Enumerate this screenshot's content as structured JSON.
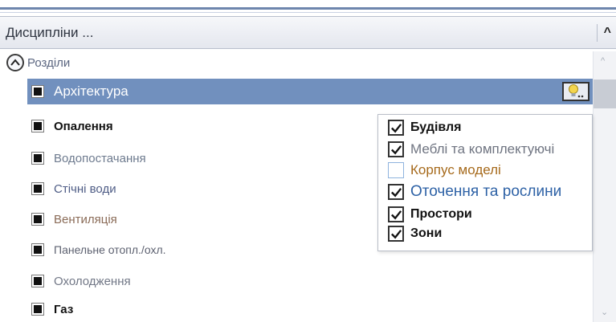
{
  "header": {
    "title": "Дисципліни ...",
    "chevron": "^"
  },
  "section": {
    "label": "Розділи"
  },
  "rows": [
    {
      "label": "Архітектура",
      "color": "#ffffff",
      "bold": false,
      "size": 17
    },
    {
      "label": "Опалення",
      "color": "#111111",
      "bold": true,
      "size": 15
    },
    {
      "label": "Водопостачання",
      "color": "#6d7a8e",
      "bold": false,
      "size": 15
    },
    {
      "label": "Стічні води",
      "color": "#4f5d86",
      "bold": false,
      "size": 15
    },
    {
      "label": "Вентиляція",
      "color": "#8a6b57",
      "bold": false,
      "size": 15
    },
    {
      "label": "Панельне отопл./охл.",
      "color": "#5d6170",
      "bold": false,
      "size": 14
    },
    {
      "label": "Охолодження",
      "color": "#717786",
      "bold": false,
      "size": 15
    },
    {
      "label": "Газ",
      "color": "#111111",
      "bold": true,
      "size": 15
    }
  ],
  "popup": {
    "items": [
      {
        "label": "Будівля",
        "checked": true,
        "color": "#111111",
        "bold": true,
        "size": 16
      },
      {
        "label": "Меблі та комплектуючі",
        "checked": true,
        "color": "#6f7481",
        "bold": false,
        "size": 17
      },
      {
        "label": "Корпус моделі",
        "checked": false,
        "color": "#a66a1c",
        "bold": false,
        "size": 17
      },
      {
        "label": "Оточення та рослини",
        "checked": true,
        "color": "#2e62a6",
        "bold": false,
        "size": 19
      },
      {
        "label": "Простори",
        "checked": true,
        "color": "#111111",
        "bold": true,
        "size": 16
      },
      {
        "label": "Зони",
        "checked": true,
        "color": "#111111",
        "bold": true,
        "size": 16
      }
    ]
  },
  "icons": {
    "bulb": "lightbulb-icon",
    "collapse": "chevron-up-circle-icon"
  },
  "colors": {
    "selected_row": "#7190be",
    "accent_rule": "#6e86ad"
  }
}
